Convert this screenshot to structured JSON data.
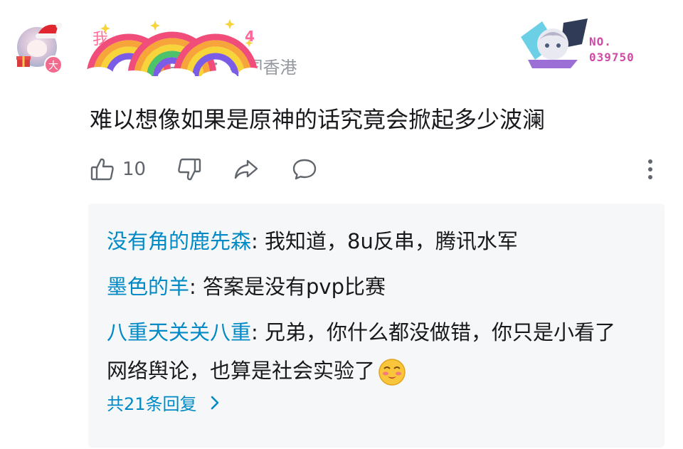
{
  "comment": {
    "user": {
      "name_visible": "我",
      "vip_tag": "4",
      "level_badge": "大",
      "location_meta": "IP属地：中国香港"
    },
    "decoration_number": "NO.\n039750",
    "text": "难以想像如果是原神的话究竟会掀起多少波澜",
    "actions": {
      "like_count": "10",
      "like_icon": "thumbs-up-icon",
      "dislike_icon": "thumbs-down-icon",
      "share_icon": "share-icon",
      "reply_icon": "comment-bubble-icon",
      "more_icon": "more-vertical-icon"
    }
  },
  "replies": [
    {
      "user": "没有角的鹿先森",
      "sep": ": ",
      "text": "我知道，8u反串，腾讯水军"
    },
    {
      "user": "墨色的羊",
      "sep": ": ",
      "text": "答案是没有pvp比赛"
    },
    {
      "user": "八重天关关八重",
      "sep": ": ",
      "text": "兄弟，你什么都没做错，你只是小看了网络舆论，也算是社会实验了",
      "emoji": "smug-face-emoji"
    }
  ],
  "more_replies_label": "共21条回复",
  "colors": {
    "reply_user": "#008ac5",
    "reply_box_bg": "#f6f7f8",
    "icon_gray": "#61666d"
  }
}
